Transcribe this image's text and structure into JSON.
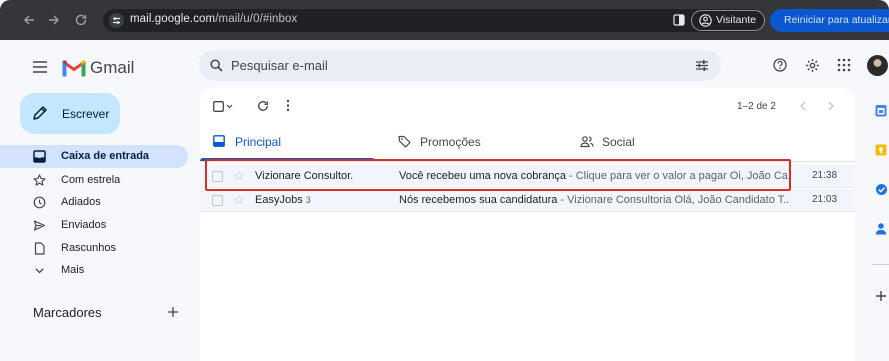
{
  "browser": {
    "url_host": "mail.google.com",
    "url_path": "/mail/u/0/#inbox",
    "profile_label": "Visitante",
    "update_button": "Reiniciar para atualizar"
  },
  "header": {
    "app_name": "Gmail",
    "search_placeholder": "Pesquisar e-mail"
  },
  "sidebar": {
    "compose_label": "Escrever",
    "items": [
      {
        "label": "Caixa de entrada",
        "icon": "inbox-icon",
        "active": true
      },
      {
        "label": "Com estrela",
        "icon": "star-icon"
      },
      {
        "label": "Adiados",
        "icon": "clock-icon"
      },
      {
        "label": "Enviados",
        "icon": "send-icon"
      },
      {
        "label": "Rascunhos",
        "icon": "draft-icon"
      },
      {
        "label": "Mais",
        "icon": "chevron-down-icon"
      }
    ],
    "labels_heading": "Marcadores"
  },
  "toolbar": {
    "pagination": "1–2 de 2"
  },
  "tabs": [
    {
      "label": "Principal",
      "icon": "inbox-icon",
      "active": true
    },
    {
      "label": "Promoções",
      "icon": "tag-icon"
    },
    {
      "label": "Social",
      "icon": "people-icon"
    }
  ],
  "emails": [
    {
      "sender": "Vizionare Consultor.",
      "count": "",
      "subject": "Você recebeu uma nova cobrança",
      "snippet": " - Clique para ver o valor a pagar Oi, João Ca...",
      "time": "21:38"
    },
    {
      "sender": "EasyJobs",
      "count": "3",
      "subject": "Nós recebemos sua candidatura",
      "snippet": " - Vizionare Consultoria Olá, João Candidato T...",
      "time": "21:03"
    }
  ],
  "colors": {
    "accent": "#0b57d0",
    "compose_bg": "#c2e7ff",
    "active_nav_bg": "#d3e3fd",
    "highlight": "#d93025"
  }
}
